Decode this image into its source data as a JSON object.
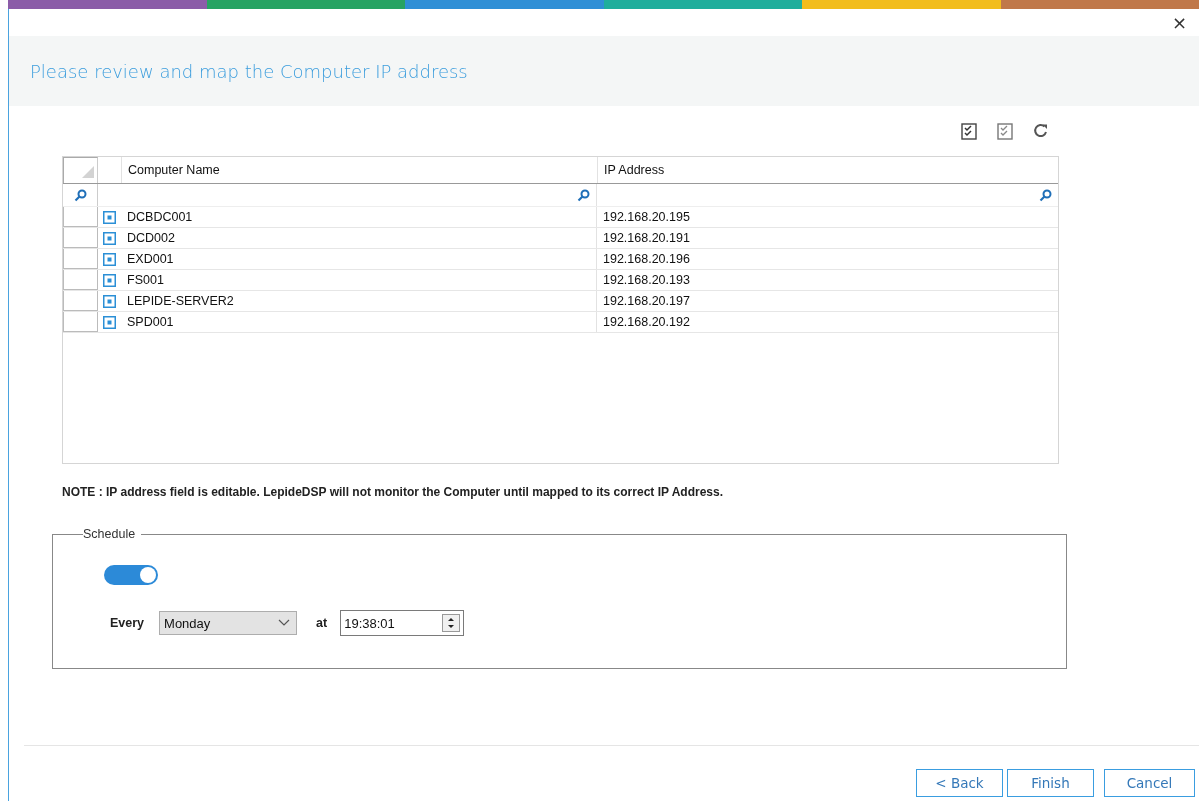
{
  "dialog": {
    "title": "Please review and map the Computer IP address",
    "close": "×"
  },
  "grid": {
    "columns": [
      "Computer Name",
      "IP Address"
    ],
    "rows": [
      {
        "name": "DCBDC001",
        "ip": "192.168.20.195"
      },
      {
        "name": "DCD002",
        "ip": "192.168.20.191"
      },
      {
        "name": "EXD001",
        "ip": "192.168.20.196"
      },
      {
        "name": "FS001",
        "ip": "192.168.20.193"
      },
      {
        "name": "LEPIDE-SERVER2",
        "ip": "192.168.20.197"
      },
      {
        "name": "SPD001",
        "ip": "192.168.20.192"
      }
    ]
  },
  "note": "NOTE : IP address field is editable. LepideDSP will not monitor the Computer until mapped to its correct IP Address.",
  "schedule": {
    "legend": "Schedule",
    "enabled": {
      "on": true
    },
    "every_label": "Every",
    "day": "Monday",
    "at_label": "at",
    "time": "19:38:01"
  },
  "buttons": [
    "< Back",
    "Finish",
    "Cancel"
  ]
}
